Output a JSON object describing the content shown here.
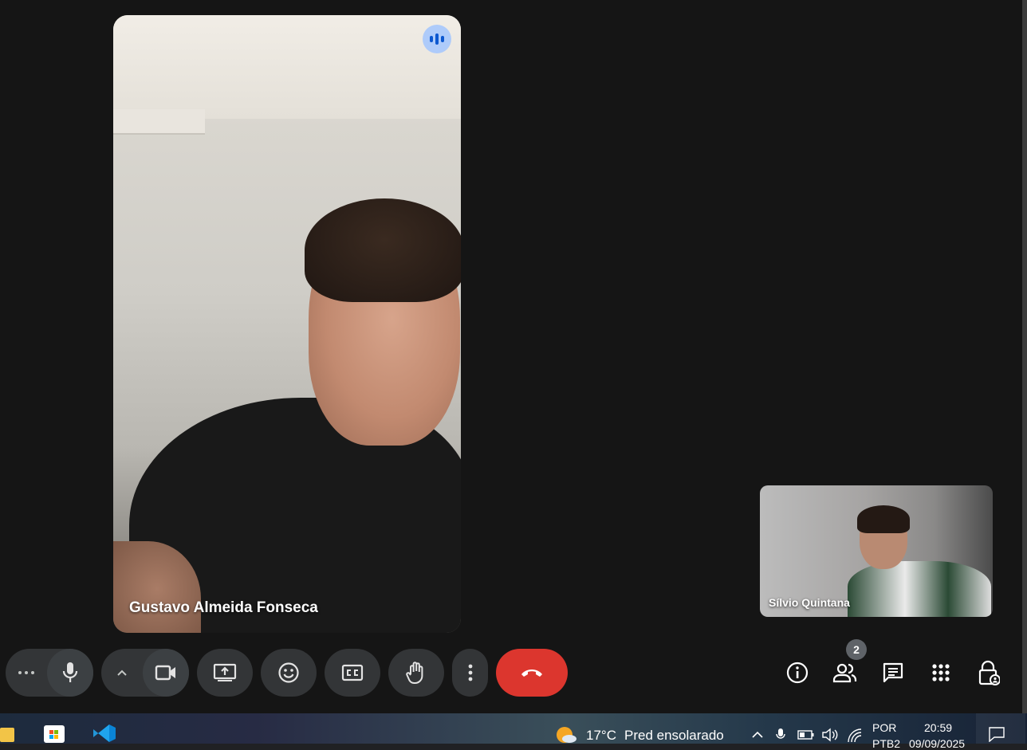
{
  "meeting": {
    "main_participant": {
      "name": "Gustavo Almeida Fonseca",
      "speaking": true
    },
    "self_participant": {
      "name": "Sílvio Quintana"
    },
    "participants_count": "2"
  },
  "controls": {
    "more_options_icon": "more-horiz-icon",
    "mic_icon": "mic-icon",
    "camera_options_icon": "chevron-up-icon",
    "camera_icon": "videocam-icon",
    "present_icon": "present-screen-icon",
    "reactions_icon": "emoji-icon",
    "captions_icon": "closed-captions-icon",
    "raise_hand_icon": "hand-icon",
    "more_icon": "more-vert-icon",
    "end_call_icon": "call-end-icon",
    "end_call_color": "#dc362e"
  },
  "right_toolbar": {
    "icons": [
      "info-icon",
      "people-icon",
      "chat-icon",
      "apps-icon",
      "host-controls-icon"
    ]
  },
  "taskbar": {
    "weather_temp": "17°C",
    "weather_text": "Pred ensolarado",
    "language_line1": "POR",
    "language_line2": "PTB2",
    "time": "20:59",
    "date": "09/09/2025"
  },
  "colors": {
    "background": "#151515",
    "control_bg": "#333537",
    "speaking_indicator": "#aecbfa"
  }
}
